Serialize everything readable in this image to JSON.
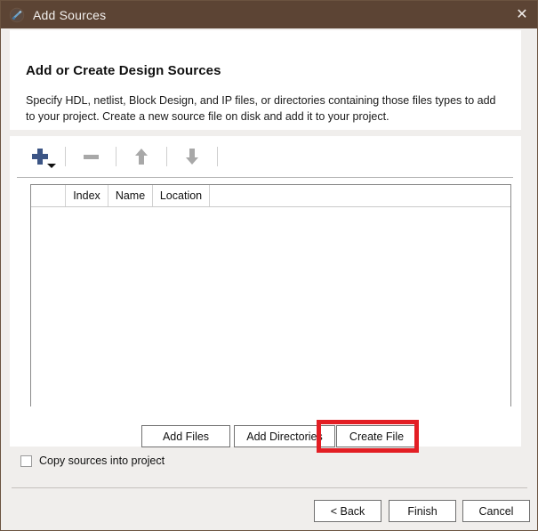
{
  "window": {
    "title": "Add Sources",
    "icon": "vivado-app-icon",
    "close_label": "✕",
    "titlebar_color": "#5c4434"
  },
  "panel": {
    "heading": "Add or Create Design Sources",
    "description": "Specify HDL, netlist, Block Design, and IP files, or directories containing those files types to add to your project. Create a new source file on disk and add it to your project."
  },
  "toolbar": {
    "add_label": "add-with-dropdown",
    "remove_label": "remove",
    "move_up_label": "move-up",
    "move_down_label": "move-down",
    "add_color": "#3c5585",
    "disabled_color": "#a8a8a8"
  },
  "source_list": {
    "columns": [
      "",
      "Index",
      "Name",
      "Location"
    ],
    "rows": []
  },
  "actions": {
    "add_files": "Add Files",
    "add_directories": "Add Directories",
    "create_file": "Create File",
    "highlight_color": "#e31e24",
    "highlighted": "create_file"
  },
  "options": {
    "copy_sources_label": "Copy sources into project",
    "copy_sources_checked": false
  },
  "footer": {
    "back": "< Back",
    "finish": "Finish",
    "cancel": "Cancel"
  }
}
